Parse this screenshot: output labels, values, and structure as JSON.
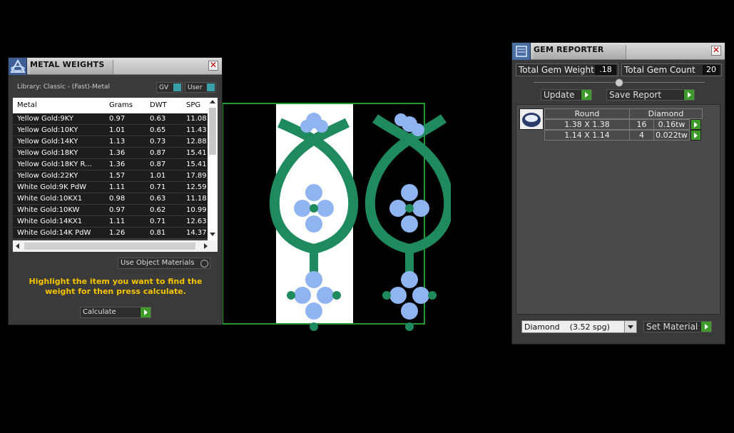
{
  "metal_weights": {
    "title": "METAL WEIGHTS",
    "library_label": "Library: Classic - (Fast)-Metal",
    "toggle_gv": "GV",
    "toggle_user": "User",
    "columns": [
      "Metal",
      "Grams",
      "DWT",
      "SPG"
    ],
    "rows": [
      [
        "Yellow Gold:9KY",
        "0.97",
        "0.63",
        "11.08"
      ],
      [
        "Yellow Gold:10KY",
        "1.01",
        "0.65",
        "11.43"
      ],
      [
        "Yellow Gold:14KY",
        "1.13",
        "0.73",
        "12.88"
      ],
      [
        "Yellow Gold:18KY",
        "1.36",
        "0.87",
        "15.41"
      ],
      [
        "Yellow Gold:18KY R...",
        "1.36",
        "0.87",
        "15.41"
      ],
      [
        "Yellow Gold:22KY",
        "1.57",
        "1.01",
        "17.89"
      ],
      [
        "White Gold:9K PdW",
        "1.11",
        "0.71",
        "12.59"
      ],
      [
        "White Gold:10KX1",
        "0.98",
        "0.63",
        "11.18"
      ],
      [
        "White Gold:10KW",
        "0.97",
        "0.62",
        "10.99"
      ],
      [
        "White Gold:14KX1",
        "1.11",
        "0.71",
        "12.63"
      ],
      [
        "White Gold:14K PdW",
        "1.26",
        "0.81",
        "14.37"
      ]
    ],
    "use_object_materials": "Use Object Materials",
    "instructions": "Highlight the item you want to find the weight for then press calculate.",
    "calculate_label": "Calculate"
  },
  "gem_reporter": {
    "title": "GEM REPORTER",
    "total_weight_label": "Total Gem Weight",
    "total_weight_value": ".18",
    "total_count_label": "Total Gem Count",
    "total_count_value": "20",
    "update_label": "Update",
    "save_report_label": "Save Report",
    "table_headers": [
      "Round",
      "Diamond"
    ],
    "rows": [
      [
        "1.38 X 1.38",
        "16",
        "0.16tw"
      ],
      [
        "1.14 X 1.14",
        "4",
        "0.022tw"
      ]
    ],
    "material_select": "Diamond    (3.52 spg)",
    "set_material_label": "Set Material"
  },
  "colors": {
    "accent_green": "#3d9a2b",
    "highlight_text": "#f5c400",
    "model_green": "#1f8a5e",
    "gem_blue": "#8fb4f0"
  }
}
